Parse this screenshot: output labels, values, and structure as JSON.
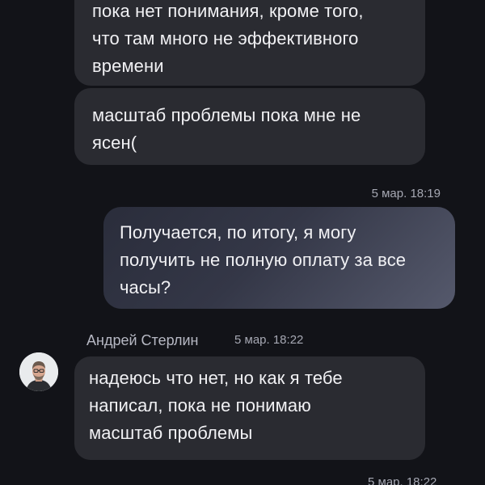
{
  "messages": [
    {
      "lines": [
        "пока нет понимания, кроме того,",
        "что там много не эффективного",
        "времени"
      ]
    },
    {
      "lines": [
        "масштаб проблемы пока мне не",
        "ясен("
      ]
    },
    {
      "timestamp": "5 мар. 18:19",
      "lines": [
        "Получается, по итогу, я могу",
        "получить не полную оплату за все",
        "часы?"
      ]
    },
    {
      "sender": "Андрей Стерлин",
      "timestamp": "5 мар. 18:22",
      "lines": [
        "надеюсь что нет, но как я тебе",
        "написал, пока не понимаю",
        "масштаб проблемы"
      ]
    },
    {
      "timestamp": "5 мар. 18:22"
    }
  ],
  "avatar_icon": "user-avatar-photo",
  "colors": {
    "background": "#121318",
    "incoming_bubble": "#2a2b31",
    "outgoing_bubble": "#343747",
    "text": "#f1f1f4",
    "meta_text": "#a6a8b3"
  }
}
